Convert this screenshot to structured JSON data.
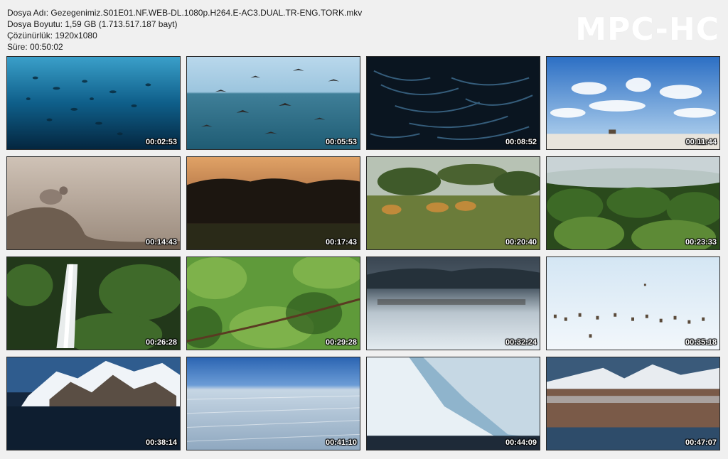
{
  "header": {
    "file_name": "Dosya Adı: Gezegenimiz.S01E01.NF.WEB-DL.1080p.H264.E-AC3.DUAL.TR-ENG.TORK.mkv",
    "file_size": "Dosya Boyutu: 1,59 GB (1.713.517.187 bayt)",
    "resolution": "Çözünürlük: 1920x1080",
    "duration": "Süre: 00:50:02"
  },
  "logo": "MPC-HC",
  "thumbnails": [
    {
      "time": "00:02:53",
      "scene": "underwater-birds"
    },
    {
      "time": "00:05:53",
      "scene": "seabirds-over-ocean"
    },
    {
      "time": "00:08:52",
      "scene": "fish-school"
    },
    {
      "time": "00:11:44",
      "scene": "salt-flat-sky"
    },
    {
      "time": "00:14:43",
      "scene": "flamingo-chick"
    },
    {
      "time": "00:17:43",
      "scene": "buffalo-silhouette"
    },
    {
      "time": "00:20:40",
      "scene": "wild-dogs-savanna"
    },
    {
      "time": "00:23:33",
      "scene": "misty-forest"
    },
    {
      "time": "00:26:28",
      "scene": "waterfall"
    },
    {
      "time": "00:29:28",
      "scene": "branch-green"
    },
    {
      "time": "00:32:24",
      "scene": "caribou-fog"
    },
    {
      "time": "00:35:18",
      "scene": "caribou-snow"
    },
    {
      "time": "00:38:14",
      "scene": "antarctic-mountains"
    },
    {
      "time": "00:41:10",
      "scene": "ice-field"
    },
    {
      "time": "00:44:09",
      "scene": "glacier"
    },
    {
      "time": "00:47:07",
      "scene": "penguin-colony"
    }
  ]
}
